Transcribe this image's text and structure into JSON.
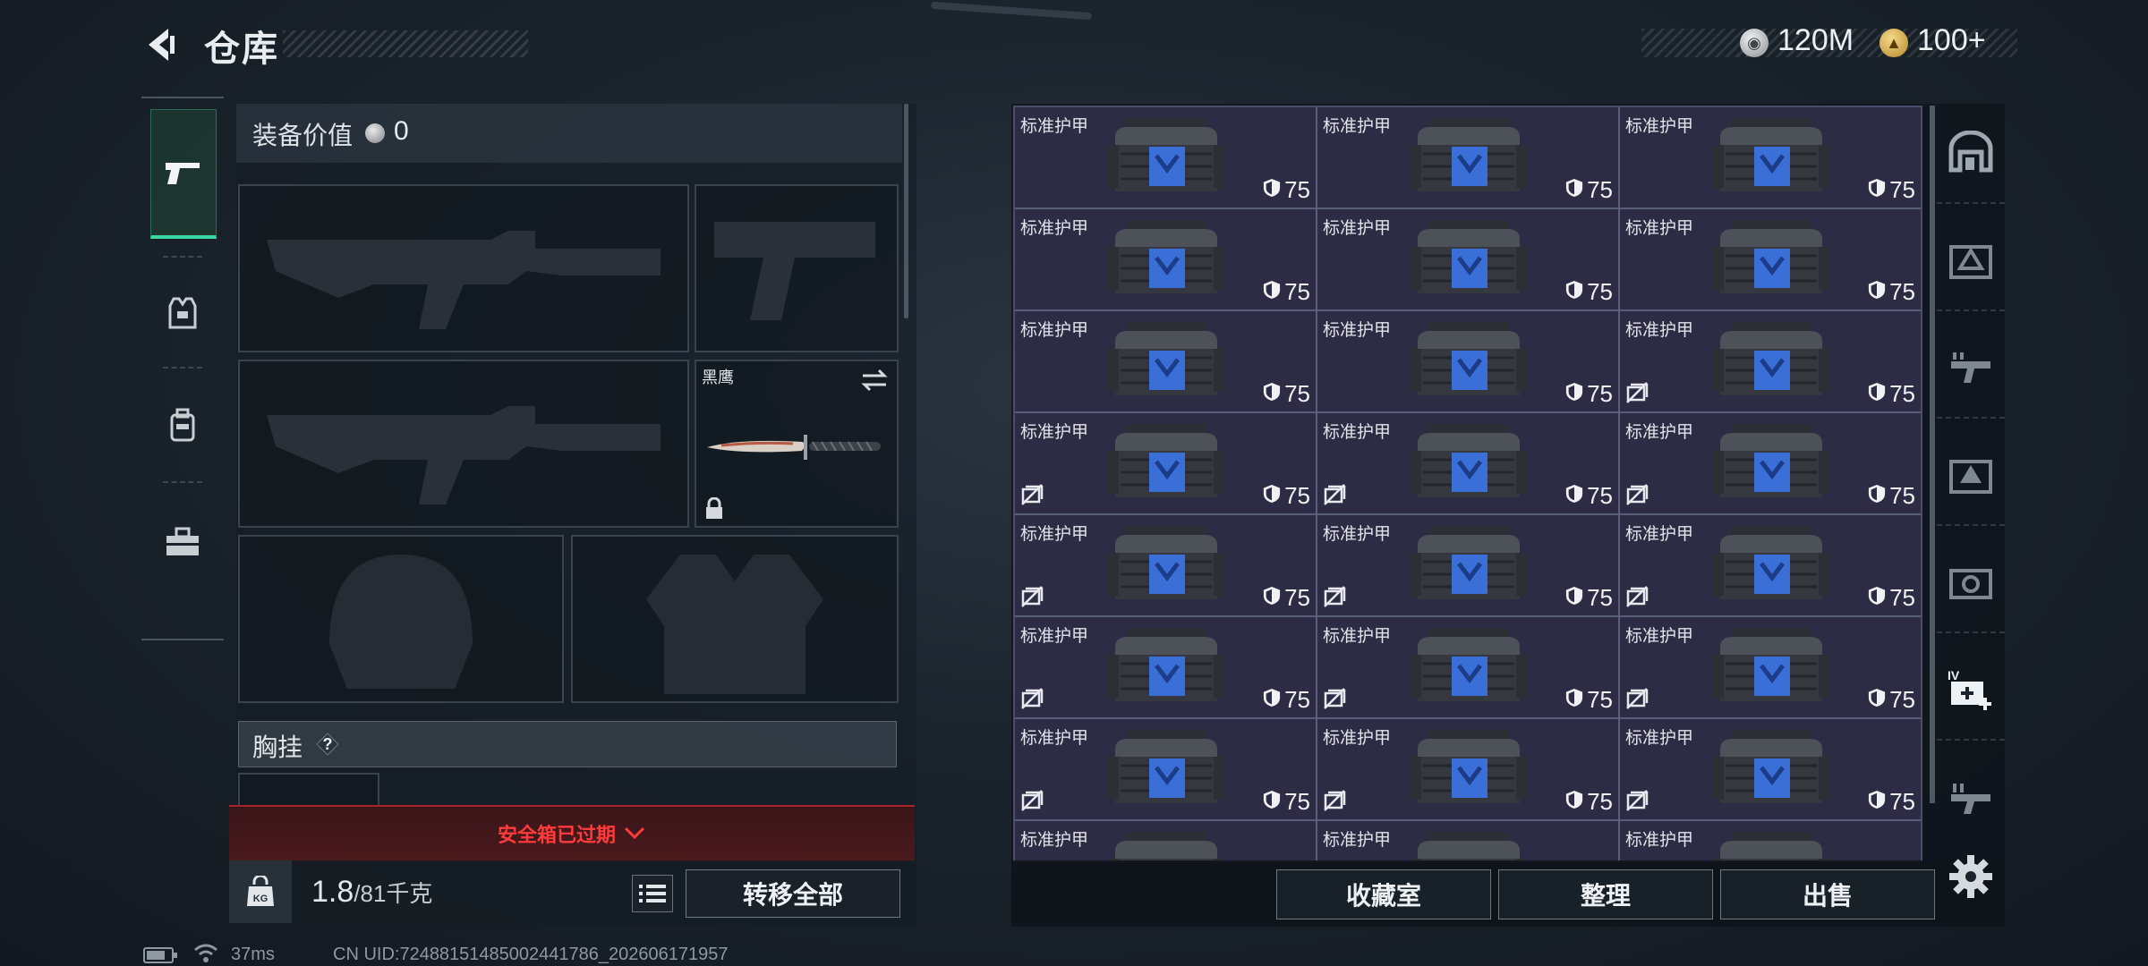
{
  "header": {
    "title": "仓库"
  },
  "currency": {
    "silver": "120M",
    "gold": "100+"
  },
  "sidebar": {
    "categories": [
      "weapon",
      "armor",
      "backpack",
      "toolbox"
    ]
  },
  "equipment": {
    "value_label": "装备价值",
    "value": "0",
    "knife_name": "黑鹰",
    "chest_rig_label": "胸挂",
    "safe_box_status": "安全箱已过期",
    "weight_current": "1.8",
    "weight_max": "/81千克",
    "transfer_all": "转移全部"
  },
  "storage": {
    "item_name": "标准护甲",
    "durability": "75",
    "rows": 8,
    "no_flag_map": [
      [
        false,
        false,
        false
      ],
      [
        false,
        false,
        false
      ],
      [
        false,
        false,
        true
      ],
      [
        true,
        true,
        true
      ],
      [
        true,
        true,
        true
      ],
      [
        true,
        true,
        true
      ],
      [
        true,
        true,
        true
      ],
      [
        false,
        false,
        false
      ]
    ],
    "buttons": {
      "collection": "收藏室",
      "organize": "整理",
      "sell": "出售"
    }
  },
  "status_bar": {
    "ping": "37ms",
    "uid": "CN UID:72488151485002441786_202606171957"
  }
}
